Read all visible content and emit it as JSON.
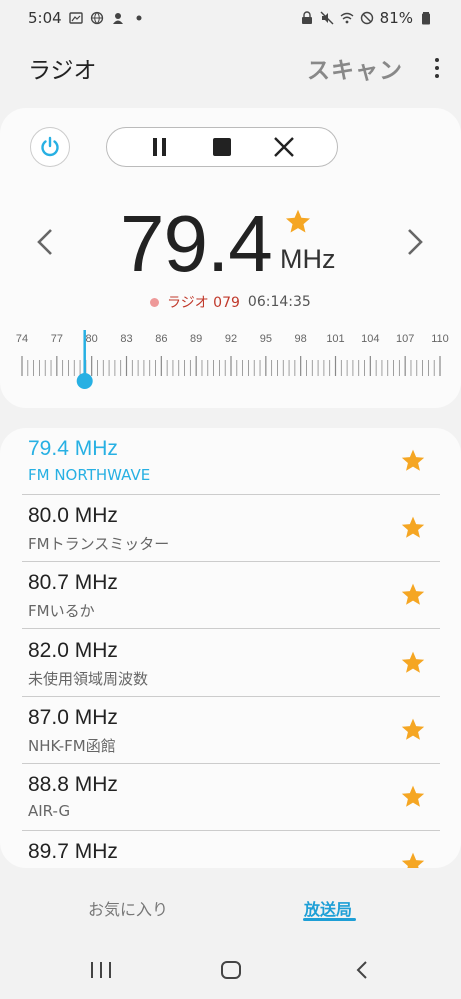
{
  "status_bar": {
    "time": "5:04",
    "battery": "81%"
  },
  "app_bar": {
    "title": "ラジオ",
    "scan_label": "スキャン"
  },
  "tuner": {
    "frequency": "79.4",
    "unit": "MHz",
    "favorite": true,
    "station_name": "ラジオ 079",
    "elapsed": "06:14:35",
    "scale_labels": [
      "74",
      "77",
      "80",
      "83",
      "86",
      "89",
      "92",
      "95",
      "98",
      "101",
      "104",
      "107",
      "110"
    ],
    "current_mhz": 79.4
  },
  "stations": [
    {
      "freq": "79.4 MHz",
      "name": "FM NORTHWAVE",
      "favorite": true,
      "active": true
    },
    {
      "freq": "80.0 MHz",
      "name": "FMトランスミッター",
      "favorite": true,
      "active": false
    },
    {
      "freq": "80.7 MHz",
      "name": "FMいるか",
      "favorite": true,
      "active": false
    },
    {
      "freq": "82.0 MHz",
      "name": "未使用領域周波数",
      "favorite": true,
      "active": false
    },
    {
      "freq": "87.0 MHz",
      "name": "NHK-FM函館",
      "favorite": true,
      "active": false
    },
    {
      "freq": "88.8 MHz",
      "name": "AIR-G",
      "favorite": true,
      "active": false
    },
    {
      "freq": "89.7 MHz",
      "name": "",
      "favorite": true,
      "active": false
    }
  ],
  "tabs": {
    "favorites": "お気に入り",
    "stations": "放送局",
    "selected": "stations"
  },
  "colors": {
    "accent": "#27b0e3",
    "star": "#f5a623",
    "record_station": "#c0392b"
  }
}
